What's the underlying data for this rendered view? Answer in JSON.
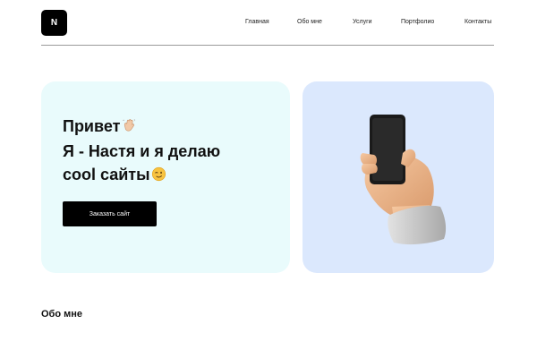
{
  "header": {
    "logo_letter": "N",
    "nav": [
      {
        "label": "Главная"
      },
      {
        "label": "Обо мне"
      },
      {
        "label": "Услуги"
      },
      {
        "label": "Портфолио"
      },
      {
        "label": "Контакты"
      }
    ]
  },
  "hero": {
    "line1": "Привет",
    "line2": "Я - Настя и я делаю",
    "line3": "cool сайты",
    "cta_label": "Заказать сайт",
    "card_color": "#e9fbfc",
    "image_card_color": "#dbe8fd",
    "icons": [
      "waving-hand-icon",
      "winking-face-icon"
    ],
    "image": "hand-holding-phone-illustration"
  },
  "about": {
    "title": "Обо мне"
  },
  "colors": {
    "accent": "#000000",
    "divider": "#9a9a9a"
  }
}
